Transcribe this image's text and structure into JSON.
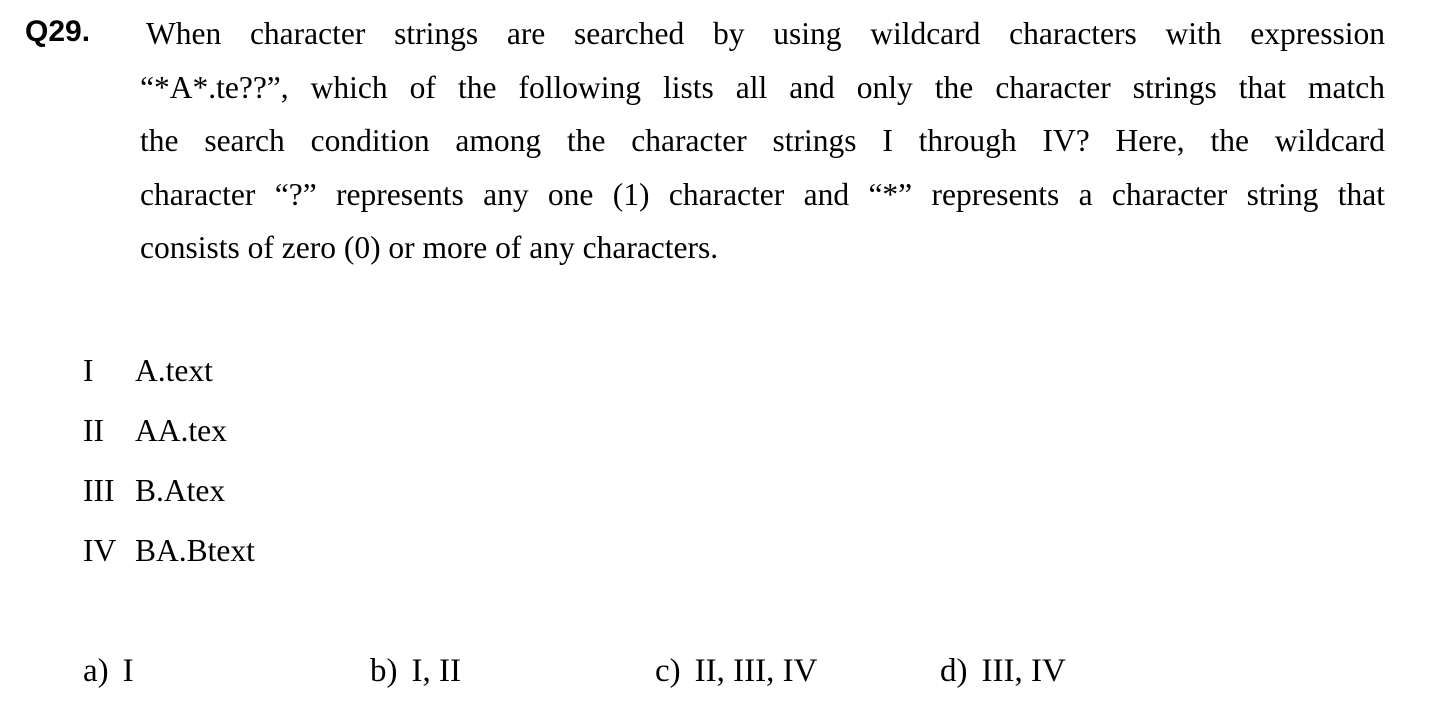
{
  "question": {
    "number": "Q29.",
    "lines": [
      "When character strings are searched by using wildcard characters with expression",
      "“*A*.te??”, which of the following lists all and only the character strings that match",
      "the search condition among the character strings I through IV? Here, the wildcard",
      "character “?” represents any one (1) character and “*” represents a character string that",
      "consists of zero (0) or more of any characters."
    ]
  },
  "items": [
    {
      "numeral": "I",
      "value": "A.text"
    },
    {
      "numeral": "II",
      "value": "AA.tex"
    },
    {
      "numeral": "III",
      "value": "B.Atex"
    },
    {
      "numeral": "IV",
      "value": "BA.Btext"
    }
  ],
  "choices": [
    {
      "letter": "a)",
      "text": "I"
    },
    {
      "letter": "b)",
      "text": "I, II"
    },
    {
      "letter": "c)",
      "text": "II, III, IV"
    },
    {
      "letter": "d)",
      "text": "III, IV"
    }
  ]
}
